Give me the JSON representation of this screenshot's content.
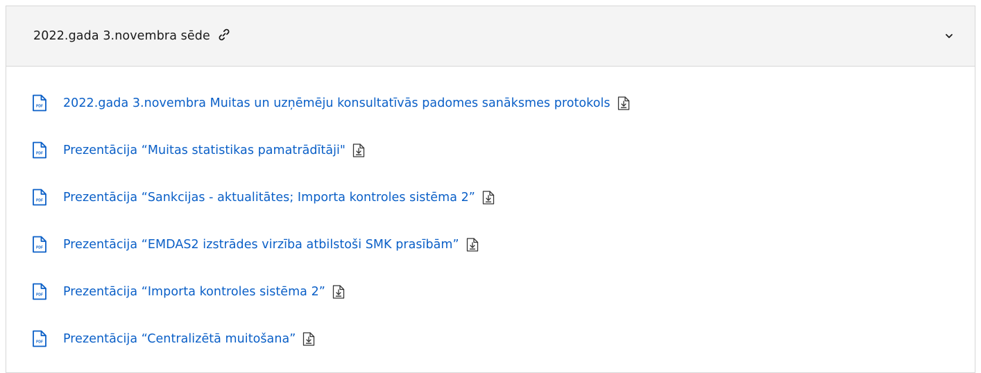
{
  "accordion": {
    "title": "2022.gada 3.novembra sēde",
    "expanded": true
  },
  "documents": [
    {
      "title": "2022.gada 3.novembra Muitas un uzņēmēju konsultatīvās padomes sanāksmes protokols",
      "file_type": "PDF"
    },
    {
      "title": "Prezentācija “Muitas statistikas pamatrādītāji\"",
      "file_type": "PDF"
    },
    {
      "title": "Prezentācija “Sankcijas - aktualitātes; Importa kontroles sistēma 2”",
      "file_type": "PDF"
    },
    {
      "title": "Prezentācija “EMDAS2 izstrādes virzība atbilstoši SMK prasībām”",
      "file_type": "PDF"
    },
    {
      "title": "Prezentācija “Importa kontroles sistēma 2”",
      "file_type": "PDF"
    },
    {
      "title": "Prezentācija “Centralizētā muitošana”",
      "file_type": "PDF"
    }
  ],
  "icons": {
    "header_link": "link-icon",
    "header_toggle": "chevron-down-icon",
    "file": "pdf-file-icon",
    "download": "download-icon"
  },
  "colors": {
    "link": "#0a5fc7",
    "header_bg": "#f4f4f4",
    "border": "#d7d7d7",
    "text": "#1a1a1a"
  }
}
